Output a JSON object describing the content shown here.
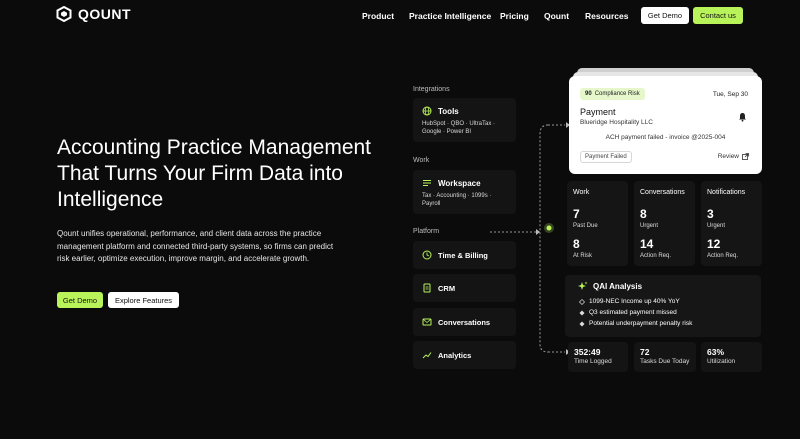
{
  "nav": {
    "brand": "QOUNT",
    "links": [
      "Product",
      "Practice Intelligence",
      "Pricing",
      "Qount",
      "Resources"
    ],
    "get_demo": "Get Demo",
    "contact": "Contact us"
  },
  "hero": {
    "title": "Accounting Practice Management That Turns Your Firm Data into Intelligence",
    "description": "Qount unifies operational, performance, and client data across the practice management platform and connected third-party systems, so firms can predict risk earlier, optimize execution, improve margin, and accelerate growth.",
    "cta_primary": "Get Demo",
    "cta_secondary": "Explore Features"
  },
  "sections": {
    "integrations": "Integrations",
    "work": "Work",
    "platform": "Platform"
  },
  "cards": {
    "tools": {
      "title": "Tools",
      "sub": "HubSpot · QBO · UltraTax · Google · Power BI"
    },
    "workspace": {
      "title": "Workspace",
      "sub": "Tax · Accounting · 1099s · Payroll"
    },
    "time_billing": {
      "title": "Time & Billing"
    },
    "crm": {
      "title": "CRM"
    },
    "conversations": {
      "title": "Conversations"
    },
    "analytics": {
      "title": "Analytics"
    }
  },
  "payment": {
    "badge_score": "90",
    "badge_label": "Compliance Risk",
    "date": "Tue, Sep 30",
    "title": "Payment",
    "client": "Blueridge Hospitality LLC",
    "message": "ACH payment failed - invoice @2025-004",
    "status": "Payment Failed",
    "review": "Review"
  },
  "tiles": {
    "work": {
      "title": "Work",
      "a_num": "7",
      "a_lbl": "Past Due",
      "b_num": "8",
      "b_lbl": "At Risk"
    },
    "conversations": {
      "title": "Conversations",
      "a_num": "8",
      "a_lbl": "Urgent",
      "b_num": "14",
      "b_lbl": "Action Req."
    },
    "notifications": {
      "title": "Notifications",
      "a_num": "3",
      "a_lbl": "Urgent",
      "b_num": "12",
      "b_lbl": "Action Req."
    }
  },
  "qai": {
    "title": "QAI Analysis",
    "items": [
      "1099-NEC Income up 40% YoY",
      "Q3 estimated payment missed",
      "Potential underpayment penalty risk"
    ]
  },
  "bottom": {
    "time": {
      "value": "352:49",
      "label": "Time Logged"
    },
    "tasks": {
      "value": "72",
      "label": "Tasks Due Today"
    },
    "util": {
      "value": "63%",
      "label": "Utilization"
    }
  },
  "colors": {
    "accent": "#b8f35a",
    "background": "#0b0b0b"
  }
}
